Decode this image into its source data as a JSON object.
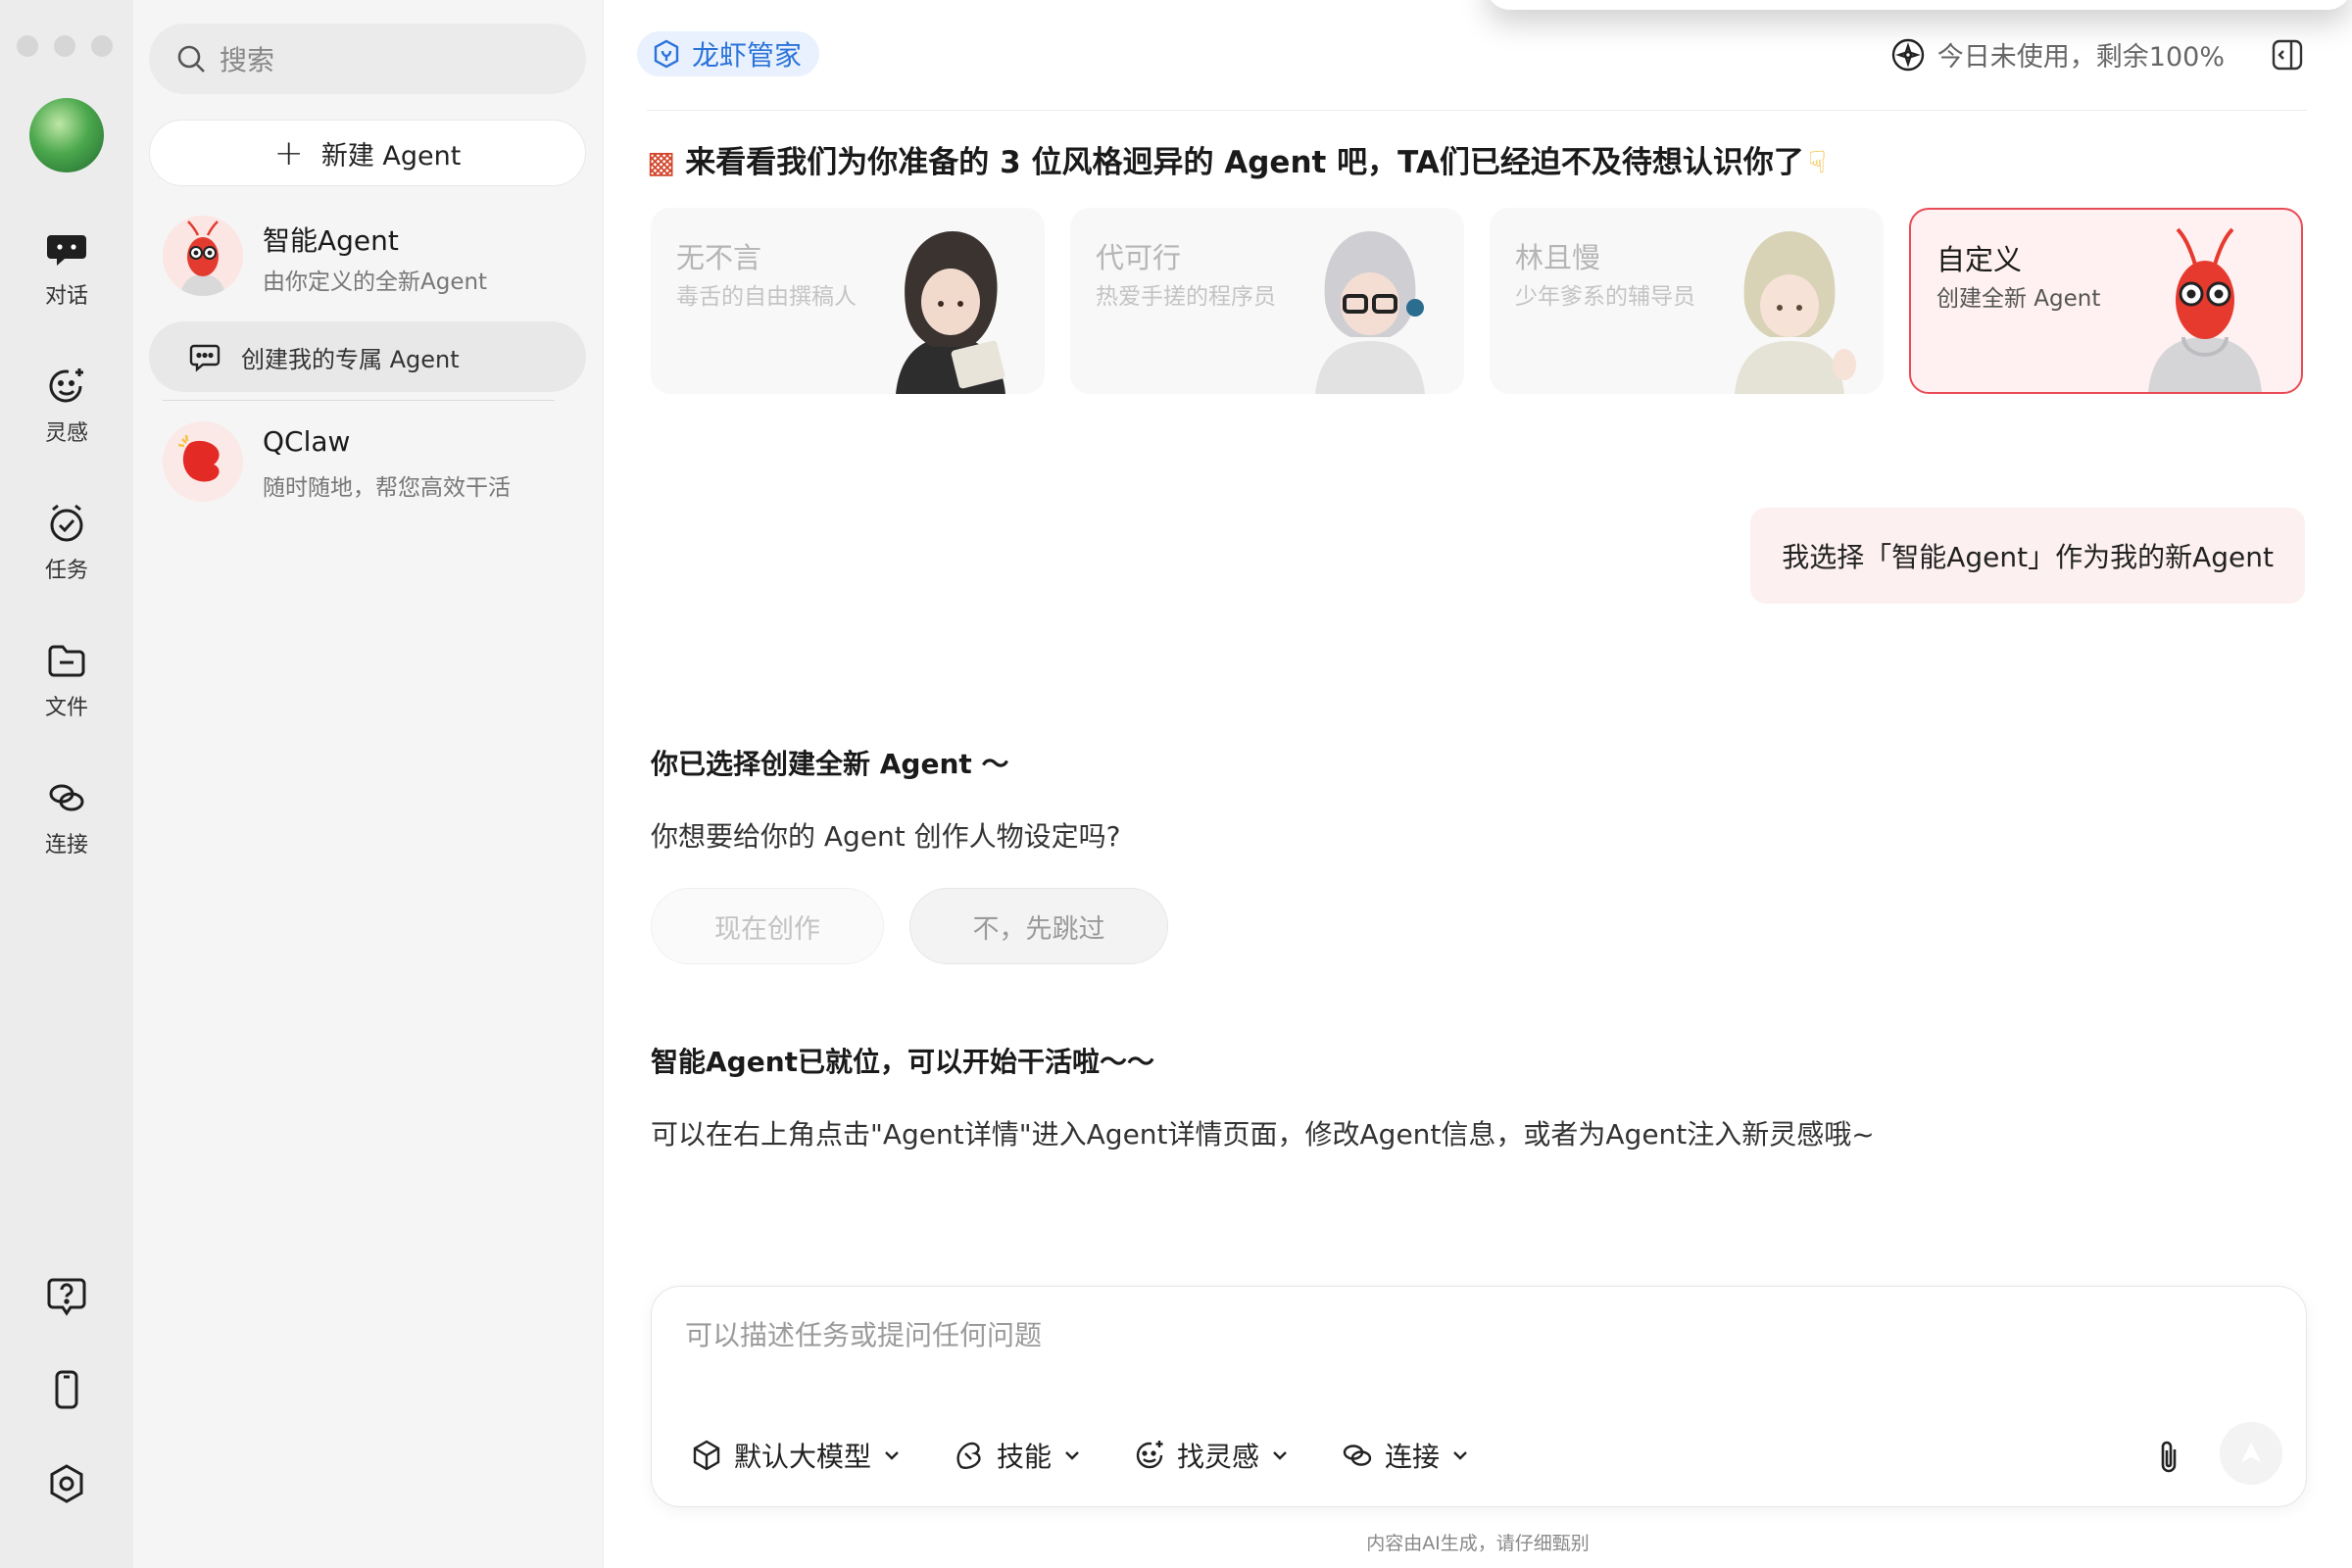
{
  "rail": {
    "items": [
      {
        "label": "对话",
        "icon": "chat-bubble-icon"
      },
      {
        "label": "灵感",
        "icon": "inspiration-face-icon"
      },
      {
        "label": "任务",
        "icon": "task-clock-icon"
      },
      {
        "label": "文件",
        "icon": "folder-icon"
      },
      {
        "label": "连接",
        "icon": "link-icon"
      }
    ],
    "bottom_icons": [
      "help-icon",
      "phone-icon",
      "settings-icon"
    ]
  },
  "sidebar": {
    "search_placeholder": "搜索",
    "new_agent_label": "新建 Agent",
    "agents": [
      {
        "name": "智能Agent",
        "desc": "由你定义的全新Agent"
      },
      {
        "name": "QClaw",
        "desc": "随时随地，帮您高效干活"
      }
    ],
    "sub_item_label": "创建我的专属 Agent"
  },
  "header": {
    "tag_label": "龙虾管家",
    "quota_text": "今日未使用，剩余100%"
  },
  "intro": {
    "text": "来看看我们为你准备的 3 位风格迥异的 Agent 吧，TA们已经迫不及待想认识你了"
  },
  "cards": [
    {
      "name": "无不言",
      "desc": "毒舌的自由撰稿人"
    },
    {
      "name": "代可行",
      "desc": "热爱手搓的程序员"
    },
    {
      "name": "林且慢",
      "desc": "少年爹系的辅导员"
    },
    {
      "name": "自定义",
      "desc": "创建全新 Agent"
    }
  ],
  "conversation": {
    "user_message": "我选择「智能Agent」作为我的新Agent",
    "bot_title_1": "你已选择创建全新 Agent ～",
    "bot_text_1": "你想要给你的 Agent 创作人物设定吗?",
    "choice_now": "现在创作",
    "choice_skip": "不，先跳过",
    "bot_title_2": "智能Agent已就位，可以开始干活啦～～",
    "bot_text_2": "可以在右上角点击\"Agent详情\"进入Agent详情页面，修改Agent信息，或者为Agent注入新灵感哦~"
  },
  "composer": {
    "placeholder": "可以描述任务或提问任何问题",
    "tools": [
      {
        "label": "默认大模型",
        "icon": "cube-icon"
      },
      {
        "label": "技能",
        "icon": "skill-icon"
      },
      {
        "label": "找灵感",
        "icon": "inspiration-face-icon"
      },
      {
        "label": "连接",
        "icon": "link-icon"
      }
    ]
  },
  "footer": {
    "disclaimer": "内容由AI生成，请仔细甄别"
  },
  "colors": {
    "accent_red": "#e94b56",
    "tag_blue": "#2b73d9",
    "bubble_pink": "#fdf0f0"
  }
}
